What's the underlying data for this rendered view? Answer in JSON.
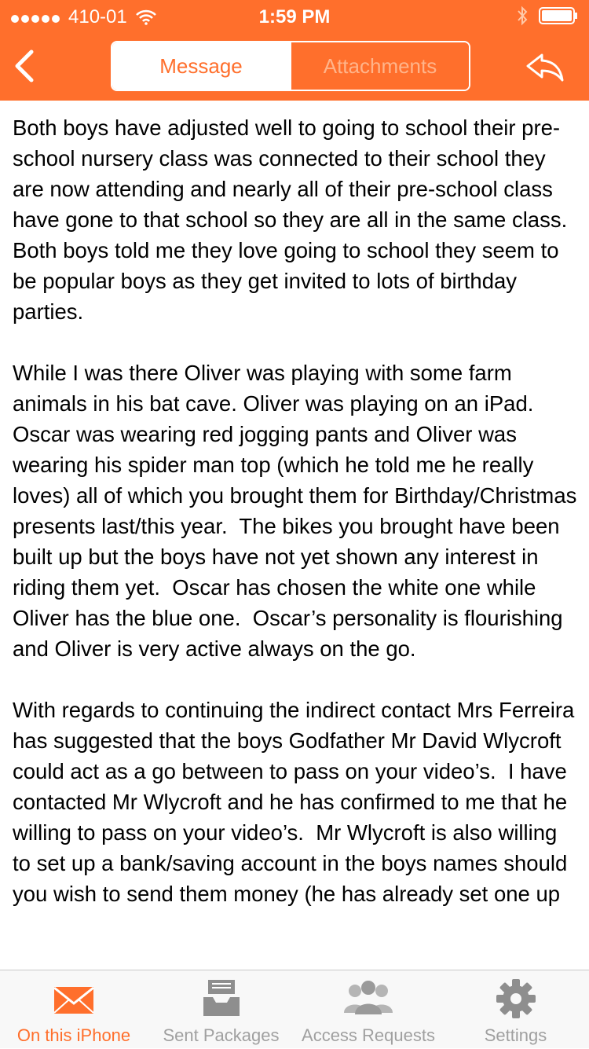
{
  "status_bar": {
    "carrier": "410-01",
    "time": "1:59 PM"
  },
  "nav": {
    "back_icon": "chevron-left-icon",
    "reply_icon": "reply-icon",
    "segments": [
      {
        "label": "Message",
        "selected": true
      },
      {
        "label": "Attachments",
        "selected": false
      }
    ]
  },
  "message": {
    "paragraphs": [
      "Both boys have adjusted well to going to school their pre-school nursery class was connected to their school they are now attending and nearly all of their pre-school class have gone to that school so they are all in the same class.  Both boys told me they love going to school they seem to be popular boys as they get invited to lots of birthday parties.",
      "While I was there Oliver was playing with some farm animals in his bat cave. Oliver was playing on an iPad.  Oscar was wearing red jogging pants and Oliver was wearing his spider man top (which he told me he really loves) all of which you brought them for Birthday/Christmas presents last/this year.  The bikes you brought have been built up but the boys have not yet shown any interest in riding them yet.  Oscar has chosen the white one while Oliver has the blue one.  Oscar’s personality is flourishing and Oliver is very active always on the go.",
      "With regards to continuing the indirect contact Mrs Ferreira has suggested that the boys Godfather Mr David Wlycroft could act as a go between to pass on your video’s.  I have contacted Mr Wlycroft and he has confirmed to me that he willing to pass on your video’s.  Mr Wlycroft is also willing to set up a bank/saving account in the boys names should you wish to send them money (he has already set one up"
    ]
  },
  "tab_bar": {
    "items": [
      {
        "label": "On this iPhone",
        "icon": "envelope-icon",
        "selected": true
      },
      {
        "label": "Sent Packages",
        "icon": "inbox-tray-icon",
        "selected": false
      },
      {
        "label": "Access Requests",
        "icon": "people-group-icon",
        "selected": false
      },
      {
        "label": "Settings",
        "icon": "gear-icon",
        "selected": false
      }
    ]
  },
  "colors": {
    "accent": "#FF6F2C",
    "tab_inactive": "#A0A0A0",
    "segment_inactive_text": "#FFB48A"
  }
}
